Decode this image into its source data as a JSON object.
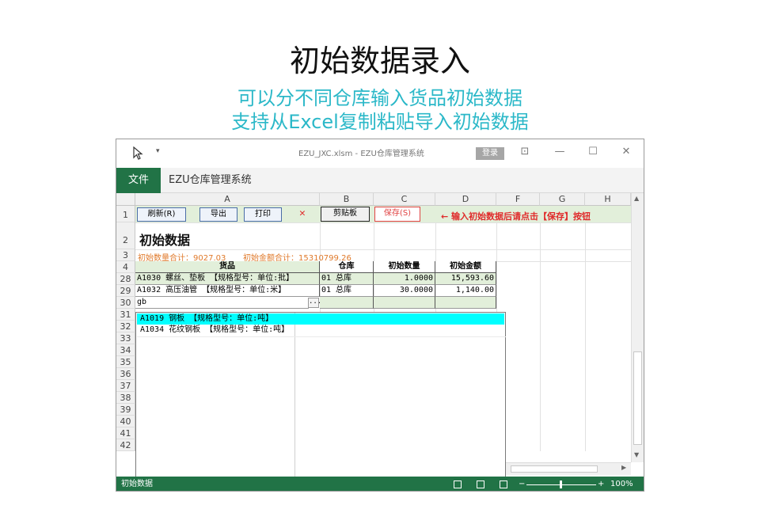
{
  "hero": {
    "title": "初始数据录入",
    "subtitle1": "可以分不同仓库输入货品初始数据",
    "subtitle2": "支持从Excel复制粘贴导入初始数据"
  },
  "window": {
    "doc_title": "EZU_JXC.xlsm  -  EZU仓库管理系统",
    "login_label": "登录",
    "file_tab": "文件",
    "system_name": "EZU仓库管理系统"
  },
  "columns": [
    "A",
    "B",
    "C",
    "D",
    "F",
    "G",
    "H"
  ],
  "rows_visible": [
    "1",
    "2",
    "3",
    "4",
    "28",
    "29",
    "30",
    "31",
    "32",
    "33",
    "34",
    "35",
    "36",
    "37",
    "38",
    "39",
    "40",
    "41",
    "42"
  ],
  "toolbar": {
    "refresh": "刷新(R)",
    "export": "导出",
    "print": "打印",
    "close_mark": "✕",
    "clipboard": "剪贴板",
    "save": "保存(S)",
    "hint": "← 输入初始数据后请点击【保存】按钮"
  },
  "sheet": {
    "title": "初始数据",
    "qty_total": "初始数量合计：9027.03",
    "amount_total": "初始金额合计：15310799.26",
    "headers": [
      "货品",
      "仓库",
      "初始数量",
      "初始金额"
    ],
    "data_rows": [
      {
        "item": "A1030 螺丝、垫板 【规格型号：单位:批】",
        "warehouse": "01 总库",
        "qty": "1.0000",
        "amount": "15,593.60"
      },
      {
        "item": "A1032 高压油管 【规格型号：单位:米】",
        "warehouse": "01 总库",
        "qty": "30.0000",
        "amount": "1,140.00"
      }
    ],
    "input_value": "gb",
    "ellipsis": "..."
  },
  "dropdown": {
    "options": [
      "A1019 钢板 【规格型号：单位:吨】",
      "A1034 花纹钢板 【规格型号：单位:吨】"
    ]
  },
  "status": {
    "sheet_name": "初始数据",
    "zoom": "100%",
    "zoom_minus": "−",
    "zoom_plus": "+"
  },
  "colors": {
    "excel_green": "#217346",
    "accent_cyan": "#2bb8c8",
    "selection": "#00ffff"
  }
}
